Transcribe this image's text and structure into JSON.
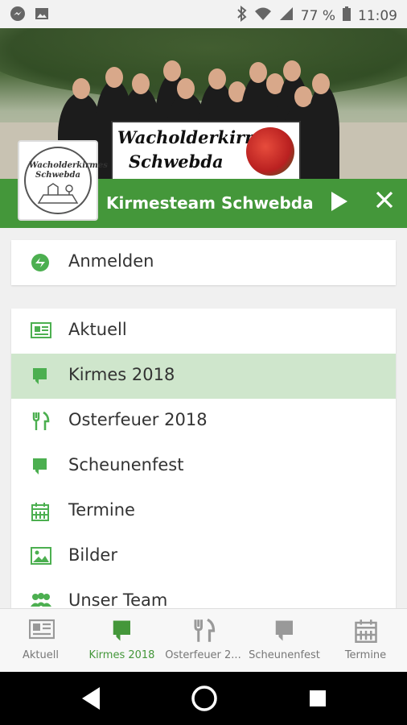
{
  "status_bar": {
    "battery": "77 %",
    "time": "11:09"
  },
  "header": {
    "title": "Kirmesteam Schwebda",
    "banner_line1": "Wacholderkirmes",
    "banner_line2": "Schwebda",
    "logo_line1": "Wacholderkirmes",
    "logo_line2": "Schwebda"
  },
  "login": {
    "label": "Anmelden",
    "icon": "login-icon"
  },
  "menu": {
    "items": [
      {
        "label": "Aktuell",
        "icon": "newspaper-icon"
      },
      {
        "label": "Kirmes 2018",
        "icon": "flag-icon",
        "selected": true
      },
      {
        "label": "Osterfeuer 2018",
        "icon": "fork-knife-icon"
      },
      {
        "label": "Scheunenfest",
        "icon": "flag-icon"
      },
      {
        "label": "Termine",
        "icon": "calendar-icon"
      },
      {
        "label": "Bilder",
        "icon": "image-icon"
      },
      {
        "label": "Unser Team",
        "icon": "group-icon"
      }
    ]
  },
  "bottom_nav": {
    "items": [
      {
        "label": "Aktuell"
      },
      {
        "label": "Kirmes 2018",
        "active": true
      },
      {
        "label": "Osterfeuer 2..."
      },
      {
        "label": "Scheunenfest"
      },
      {
        "label": "Termine"
      }
    ]
  },
  "colors": {
    "primary": "#44973a",
    "selected_bg": "#cfe6cc",
    "icon": "#4caf50"
  }
}
